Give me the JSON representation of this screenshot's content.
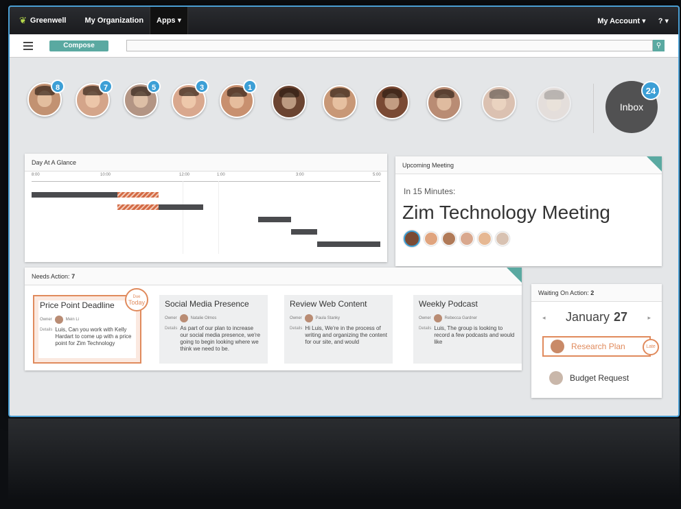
{
  "topbar": {
    "brand": "Greenwell",
    "nav": [
      "My Organization",
      "Apps ▾"
    ],
    "account": "My Account ▾",
    "help": "? ▾"
  },
  "toolbar": {
    "compose_label": "Compose",
    "search_placeholder": ""
  },
  "contacts": [
    {
      "badge": "8",
      "skin": "#c29272"
    },
    {
      "badge": "7",
      "skin": "#d4a58a"
    },
    {
      "badge": "5",
      "skin": "#b39584"
    },
    {
      "badge": "3",
      "skin": "#d9a88e"
    },
    {
      "badge": "1",
      "skin": "#c8906f"
    },
    {
      "badge": "",
      "skin": "#6b4431"
    },
    {
      "badge": "",
      "skin": "#c89877"
    },
    {
      "badge": "",
      "skin": "#7a4a34"
    },
    {
      "badge": "",
      "skin": "#b98c74"
    },
    {
      "badge": "",
      "skin": "#d8b29a"
    },
    {
      "badge": "",
      "skin": "#e6d2c4"
    }
  ],
  "inbox": {
    "label": "Inbox",
    "count": "24"
  },
  "day_at_glance": {
    "title": "Day At A Glance",
    "ticks": [
      "8:00",
      "10:00",
      "12:00",
      "1:00",
      "3:00",
      "5:00"
    ]
  },
  "upcoming_meeting": {
    "title": "Upcoming Meeting",
    "subtitle": "In 15 Minutes:",
    "meeting_name": "Zim Technology Meeting",
    "attendees": [
      "#7a4a34",
      "#e0a47e",
      "#b07a58",
      "#d9a88e",
      "#e6b893",
      "#d8c2b2"
    ]
  },
  "needs_action": {
    "title": "Needs Action:",
    "count": "7",
    "tasks": [
      {
        "title": "Price Point Deadline",
        "owner_label": "Owner",
        "owner": "Mein Li",
        "details_label": "Details",
        "details": "Luis, Can you work with Kelly Hardart to come up with a price point for Zim Technology",
        "due_small": "Due",
        "due_big": "Today"
      },
      {
        "title": "Social Media Presence",
        "owner_label": "Owner",
        "owner": "Natalie Olmos",
        "details_label": "Details",
        "details": "As part of our plan to increase our social media presence, we're going to begin looking where we think we need to be."
      },
      {
        "title": "Review Web Content",
        "owner_label": "Owner",
        "owner": "Paula Stanky",
        "details_label": "Details",
        "details": "Hi Luis, We're in the process of writing and organizing the content for our site, and would"
      },
      {
        "title": "Weekly Podcast",
        "owner_label": "Owner",
        "owner": "Rebecca Gardner",
        "details_label": "Details",
        "details": "Luis, The group is looking to record a few podcasts and would like"
      }
    ]
  },
  "waiting_on_action": {
    "title": "Waiting On Action:",
    "count": "2",
    "month": "January",
    "day": "27",
    "prev": "◂",
    "next": "▸",
    "items": [
      {
        "label": "Research Plan",
        "late": "Late"
      },
      {
        "label": "Budget Request"
      }
    ]
  }
}
